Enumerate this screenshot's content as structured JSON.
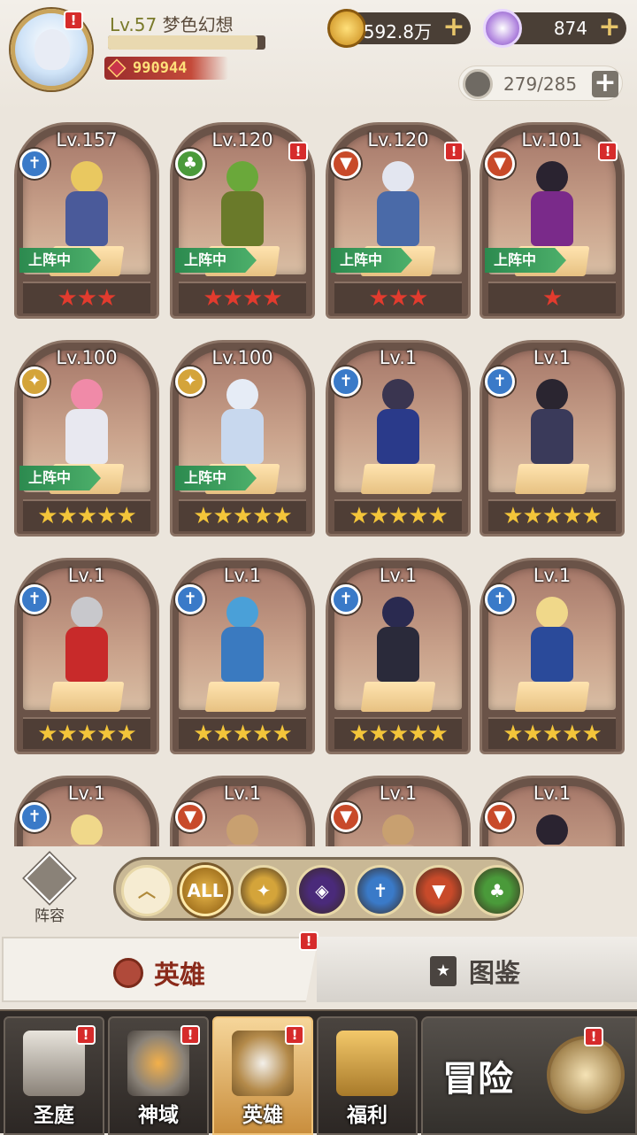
{
  "player": {
    "level": "Lv.57",
    "name": "梦色幻想",
    "xp_fraction": 0.95,
    "power": "990944"
  },
  "resources": {
    "gold": "592.8万",
    "gems": "874",
    "capacity": "279/285"
  },
  "heroes": [
    {
      "level": "Lv.157",
      "faction": "light",
      "stars": 3,
      "star_color": "red",
      "on_team": true,
      "alert": false,
      "tint": "#e9c860",
      "body": "#4a5a9a"
    },
    {
      "level": "Lv.120",
      "faction": "nature",
      "stars": 4,
      "star_color": "red",
      "on_team": true,
      "alert": true,
      "tint": "#6aa83a",
      "body": "#6a7a2a"
    },
    {
      "level": "Lv.120",
      "faction": "beast",
      "stars": 3,
      "star_color": "red",
      "on_team": true,
      "alert": true,
      "tint": "#e3e6f0",
      "body": "#4a6aa8"
    },
    {
      "level": "Lv.101",
      "faction": "beast",
      "stars": 1,
      "star_color": "red",
      "on_team": true,
      "alert": true,
      "tint": "#2a2330",
      "body": "#7a2a8a"
    },
    {
      "level": "Lv.100",
      "faction": "holy",
      "stars": 5,
      "star_color": "gold",
      "on_team": true,
      "alert": false,
      "tint": "#f08aa8",
      "body": "#e8e8f0"
    },
    {
      "level": "Lv.100",
      "faction": "holy",
      "stars": 5,
      "star_color": "gold",
      "on_team": true,
      "alert": false,
      "tint": "#e6ecf6",
      "body": "#c8d8ee"
    },
    {
      "level": "Lv.1",
      "faction": "light",
      "stars": 5,
      "star_color": "gold",
      "on_team": false,
      "alert": false,
      "tint": "#3a3550",
      "body": "#2a3a8a"
    },
    {
      "level": "Lv.1",
      "faction": "light",
      "stars": 5,
      "star_color": "gold",
      "on_team": false,
      "alert": false,
      "tint": "#2a2530",
      "body": "#3a3a5a"
    },
    {
      "level": "Lv.1",
      "faction": "light",
      "stars": 5,
      "star_color": "gold",
      "on_team": false,
      "alert": false,
      "tint": "#c8c8cc",
      "body": "#c82a2a"
    },
    {
      "level": "Lv.1",
      "faction": "light",
      "stars": 5,
      "star_color": "gold",
      "on_team": false,
      "alert": false,
      "tint": "#4aa0d8",
      "body": "#3a7ac0"
    },
    {
      "level": "Lv.1",
      "faction": "light",
      "stars": 5,
      "star_color": "gold",
      "on_team": false,
      "alert": false,
      "tint": "#2a2a50",
      "body": "#2a2a3a"
    },
    {
      "level": "Lv.1",
      "faction": "light",
      "stars": 5,
      "star_color": "gold",
      "on_team": false,
      "alert": false,
      "tint": "#f0d88a",
      "body": "#2a4a9a"
    },
    {
      "level": "Lv.1",
      "faction": "light",
      "stars": 0,
      "star_color": "gold",
      "on_team": false,
      "alert": false,
      "tint": "#f0d88a",
      "body": "#caa38c"
    },
    {
      "level": "Lv.1",
      "faction": "beast",
      "stars": 0,
      "star_color": "gold",
      "on_team": false,
      "alert": false,
      "tint": "#c8a070",
      "body": "#caa38c"
    },
    {
      "level": "Lv.1",
      "faction": "beast",
      "stars": 0,
      "star_color": "gold",
      "on_team": false,
      "alert": false,
      "tint": "#c8a070",
      "body": "#caa38c"
    },
    {
      "level": "Lv.1",
      "faction": "beast",
      "stars": 0,
      "star_color": "gold",
      "on_team": false,
      "alert": false,
      "tint": "#2a2330",
      "body": "#caa38c"
    }
  ],
  "on_team_label": "上阵中",
  "lineup_label": "阵容",
  "filters": [
    {
      "name": "collapse",
      "label": "︿",
      "color": "#f3e6c4"
    },
    {
      "name": "all",
      "label": "ALL",
      "color": "#c99a3a"
    },
    {
      "name": "holy",
      "label": "✦",
      "color": "#d4a43a"
    },
    {
      "name": "dark",
      "label": "◈",
      "color": "#4a2a7a"
    },
    {
      "name": "light",
      "label": "✝",
      "color": "#3a7ac8"
    },
    {
      "name": "beast",
      "label": "▼",
      "color": "#c84a2a"
    },
    {
      "name": "nature",
      "label": "♣",
      "color": "#4a9a3a"
    }
  ],
  "tabs": {
    "heroes": "英雄",
    "codex": "图鉴"
  },
  "bottom_nav": {
    "sanctuary": "圣庭",
    "divine": "神域",
    "heroes": "英雄",
    "welfare": "福利",
    "adventure": "冒险"
  },
  "faction_colors": {
    "light": "#3a7ac8",
    "nature": "#4a9a3a",
    "beast": "#c84a2a",
    "holy": "#d4a43a",
    "dark": "#4a2a7a"
  },
  "faction_glyphs": {
    "light": "✝",
    "nature": "♣",
    "beast": "▼",
    "holy": "✦",
    "dark": "◈"
  }
}
